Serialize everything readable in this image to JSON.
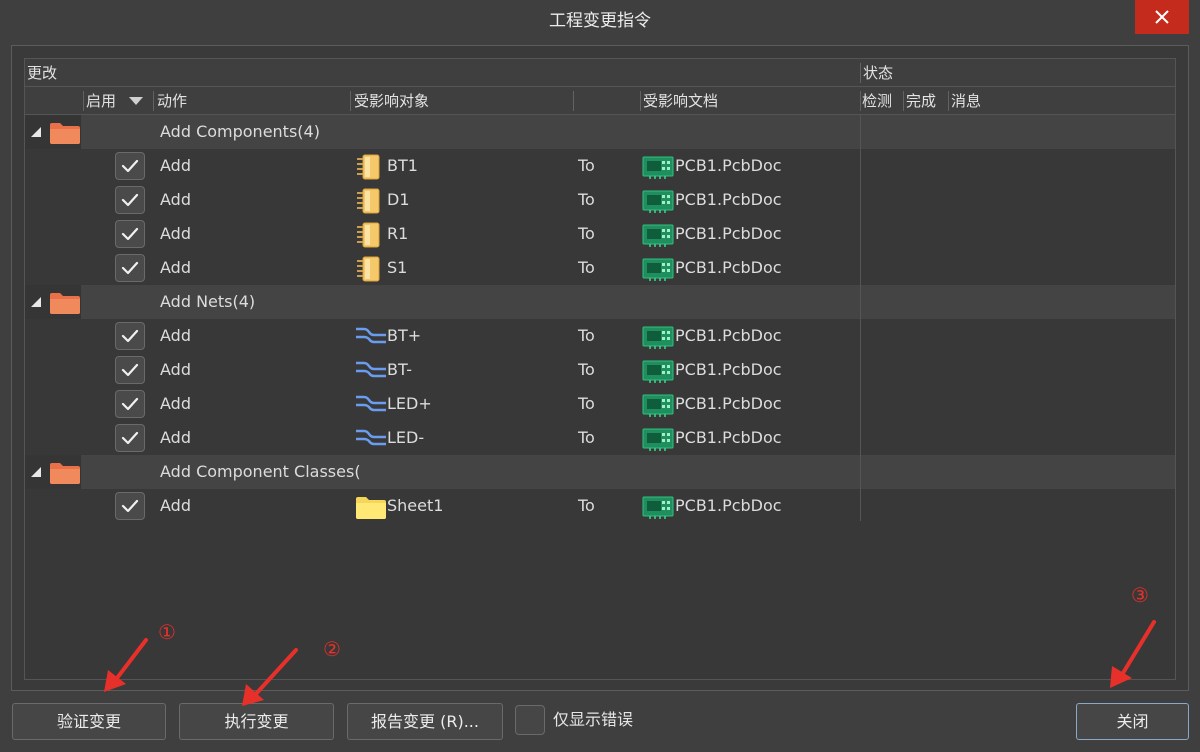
{
  "window": {
    "title": "工程变更指令",
    "close_icon": "close-icon"
  },
  "header": {
    "group_change": "更改",
    "group_status": "状态",
    "col_enable": "启用",
    "col_action": "动作",
    "col_target": "受影响对象",
    "col_doc": "受影响文档",
    "col_check": "检测",
    "col_done": "完成",
    "col_message": "消息"
  },
  "groups": [
    {
      "title": "Add Components(4)",
      "icon": "folder-icon",
      "items": [
        {
          "action": "Add",
          "target": "BT1",
          "target_icon": "component-icon",
          "to": "To",
          "doc": "PCB1.PcbDoc",
          "checked": true
        },
        {
          "action": "Add",
          "target": "D1",
          "target_icon": "component-icon",
          "to": "To",
          "doc": "PCB1.PcbDoc",
          "checked": true
        },
        {
          "action": "Add",
          "target": "R1",
          "target_icon": "component-icon",
          "to": "To",
          "doc": "PCB1.PcbDoc",
          "checked": true
        },
        {
          "action": "Add",
          "target": "S1",
          "target_icon": "component-icon",
          "to": "To",
          "doc": "PCB1.PcbDoc",
          "checked": true
        }
      ]
    },
    {
      "title": "Add Nets(4)",
      "icon": "folder-icon",
      "items": [
        {
          "action": "Add",
          "target": "BT+",
          "target_icon": "net-icon",
          "to": "To",
          "doc": "PCB1.PcbDoc",
          "checked": true
        },
        {
          "action": "Add",
          "target": "BT-",
          "target_icon": "net-icon",
          "to": "To",
          "doc": "PCB1.PcbDoc",
          "checked": true
        },
        {
          "action": "Add",
          "target": "LED+",
          "target_icon": "net-icon",
          "to": "To",
          "doc": "PCB1.PcbDoc",
          "checked": true
        },
        {
          "action": "Add",
          "target": "LED-",
          "target_icon": "net-icon",
          "to": "To",
          "doc": "PCB1.PcbDoc",
          "checked": true
        }
      ]
    },
    {
      "title": "Add Component Classes(",
      "icon": "folder-icon",
      "items": [
        {
          "action": "Add",
          "target": "Sheet1",
          "target_icon": "sheet-folder-icon",
          "to": "To",
          "doc": "PCB1.PcbDoc",
          "checked": true
        }
      ]
    }
  ],
  "footer": {
    "validate": "验证变更",
    "execute": "执行变更",
    "report": "报告变更 (R)...",
    "only_errors": "仅显示错误",
    "close": "关闭"
  },
  "annotations": [
    "①",
    "②",
    "③"
  ],
  "colors": {
    "annotation": "#e8302a",
    "close_button": "#c42b1c",
    "group_icon": "#e8714a"
  }
}
